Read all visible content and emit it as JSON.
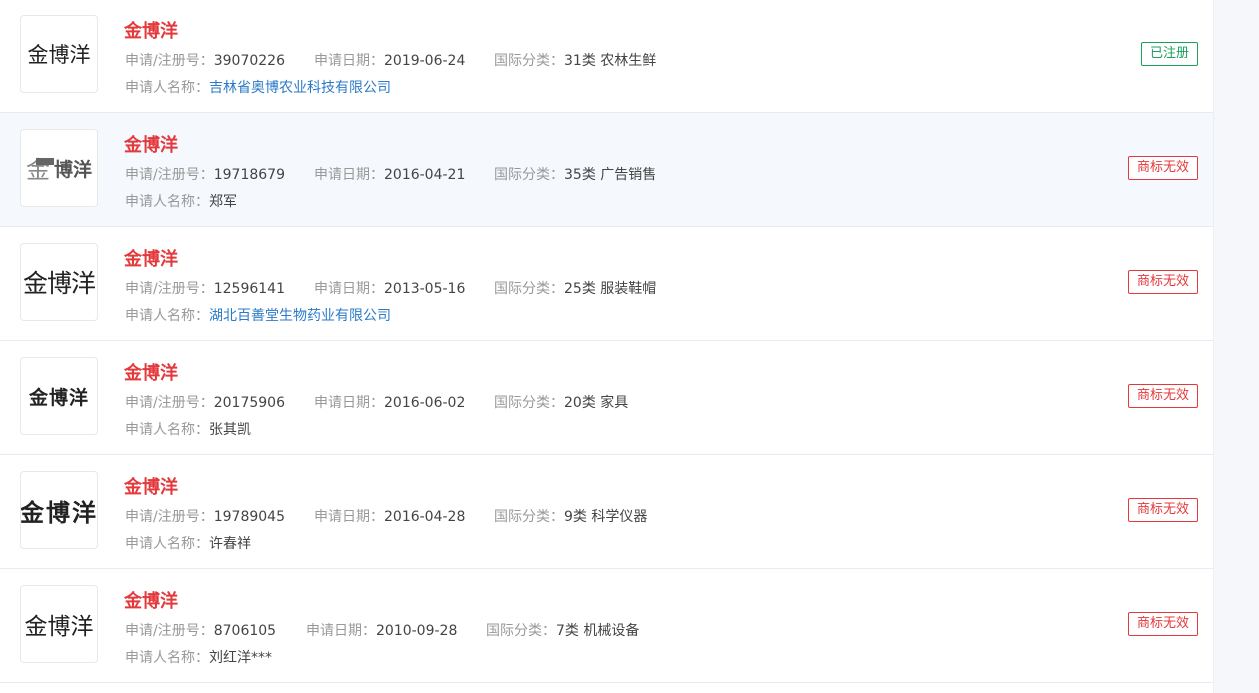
{
  "labels": {
    "reg_no": "申请/注册号：",
    "app_date": "申请日期：",
    "intl_class": "国际分类：",
    "applicant": "申请人名称："
  },
  "colors": {
    "title": "#e4393c",
    "registered": "#1aa05a",
    "invalid": "#e4393c",
    "link": "#2a7ac8"
  },
  "trademarks": [
    {
      "logo_text": "金博洋",
      "name": "金博洋",
      "reg_no": "39070226",
      "app_date": "2019-06-24",
      "intl_class": "31类 农林生鲜",
      "applicant": "吉林省奥博农业科技有限公司",
      "status": "已注册"
    },
    {
      "logo_text": "博洋",
      "logo_prefix": "金",
      "name": "金博洋",
      "reg_no": "19718679",
      "app_date": "2016-04-21",
      "intl_class": "35类 广告销售",
      "applicant": "郑军",
      "status": "商标无效"
    },
    {
      "logo_text": "金博洋",
      "name": "金博洋",
      "reg_no": "12596141",
      "app_date": "2013-05-16",
      "intl_class": "25类 服装鞋帽",
      "applicant": "湖北百善堂生物药业有限公司",
      "status": "商标无效"
    },
    {
      "logo_text": "金博洋",
      "name": "金博洋",
      "reg_no": "20175906",
      "app_date": "2016-06-02",
      "intl_class": "20类 家具",
      "applicant": "张其凯",
      "status": "商标无效"
    },
    {
      "logo_text": "金博洋",
      "name": "金博洋",
      "reg_no": "19789045",
      "app_date": "2016-04-28",
      "intl_class": "9类 科学仪器",
      "applicant": "许春祥",
      "status": "商标无效"
    },
    {
      "logo_text": "金博洋",
      "name": "金博洋",
      "reg_no": "8706105",
      "app_date": "2010-09-28",
      "intl_class": "7类 机械设备",
      "applicant": "刘红洋***",
      "status": "商标无效"
    }
  ]
}
